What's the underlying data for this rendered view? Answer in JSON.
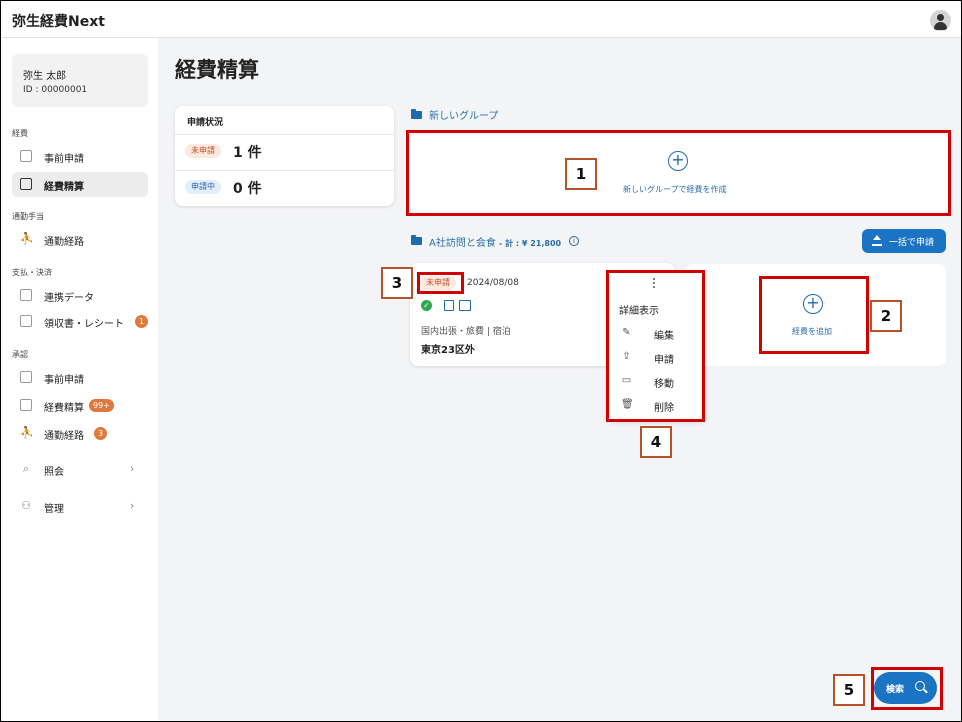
{
  "app": {
    "title": "弥生経費Next"
  },
  "user": {
    "name": "弥生 太郎",
    "id": "ID : 00000001"
  },
  "sidebar": {
    "sections": [
      {
        "label": "経費"
      },
      {
        "label": "通勤手当"
      },
      {
        "label": "支払・決済"
      },
      {
        "label": "承認"
      }
    ],
    "items": [
      {
        "label": "事前申請",
        "icon": "form-icon"
      },
      {
        "label": "経費精算",
        "icon": "receipt-icon",
        "active": true
      },
      {
        "label": "通勤経路",
        "icon": "walk-icon"
      },
      {
        "label": "連携データ",
        "icon": "linked-data-icon"
      },
      {
        "label": "領収書・レシート",
        "icon": "receipt-icon",
        "badge": "1"
      },
      {
        "label": "事前申請",
        "icon": "approve-form-icon"
      },
      {
        "label": "経費精算",
        "icon": "approve-expense-icon",
        "badge": "99+"
      },
      {
        "label": "通勤経路",
        "icon": "approve-route-icon",
        "badge": "3"
      },
      {
        "label": "照会",
        "icon": "search-icon"
      },
      {
        "label": "管理",
        "icon": "users-icon"
      }
    ]
  },
  "main": {
    "title": "経費精算",
    "status": {
      "title": "申請状況",
      "rows": [
        {
          "pill": "未申請",
          "count": "1 件"
        },
        {
          "pill": "申請中",
          "count": "0 件"
        }
      ]
    },
    "new_group": {
      "header": "新しいグループ",
      "create_label": "新しいグループで経費を作成"
    },
    "group": {
      "header": "A社訪問と会食",
      "total": "- 計 : ¥ 21,800",
      "bulk_button": "一括で申請",
      "expense": {
        "status": "未申請",
        "date": "2024/08/08",
        "category": "国内出張・旅費 | 宿泊",
        "destination": "東京23区外"
      },
      "add_label": "経費を追加"
    },
    "context_menu": {
      "header": "詳細表示",
      "items": [
        {
          "label": "編集",
          "icon": "pencil-icon"
        },
        {
          "label": "申請",
          "icon": "upload-icon"
        },
        {
          "label": "移動",
          "icon": "folder-move-icon"
        },
        {
          "label": "削除",
          "icon": "trash-icon"
        }
      ]
    },
    "search_button": "検索"
  },
  "annotations": [
    "1",
    "2",
    "3",
    "4",
    "5"
  ],
  "colors": {
    "primary": "#1b73c4",
    "highlight": "#d40000",
    "badge": "#e0793c",
    "draft_pill": "#fde9df",
    "pending_pill": "#e3eefb",
    "main_bg": "#f3f4f6"
  }
}
